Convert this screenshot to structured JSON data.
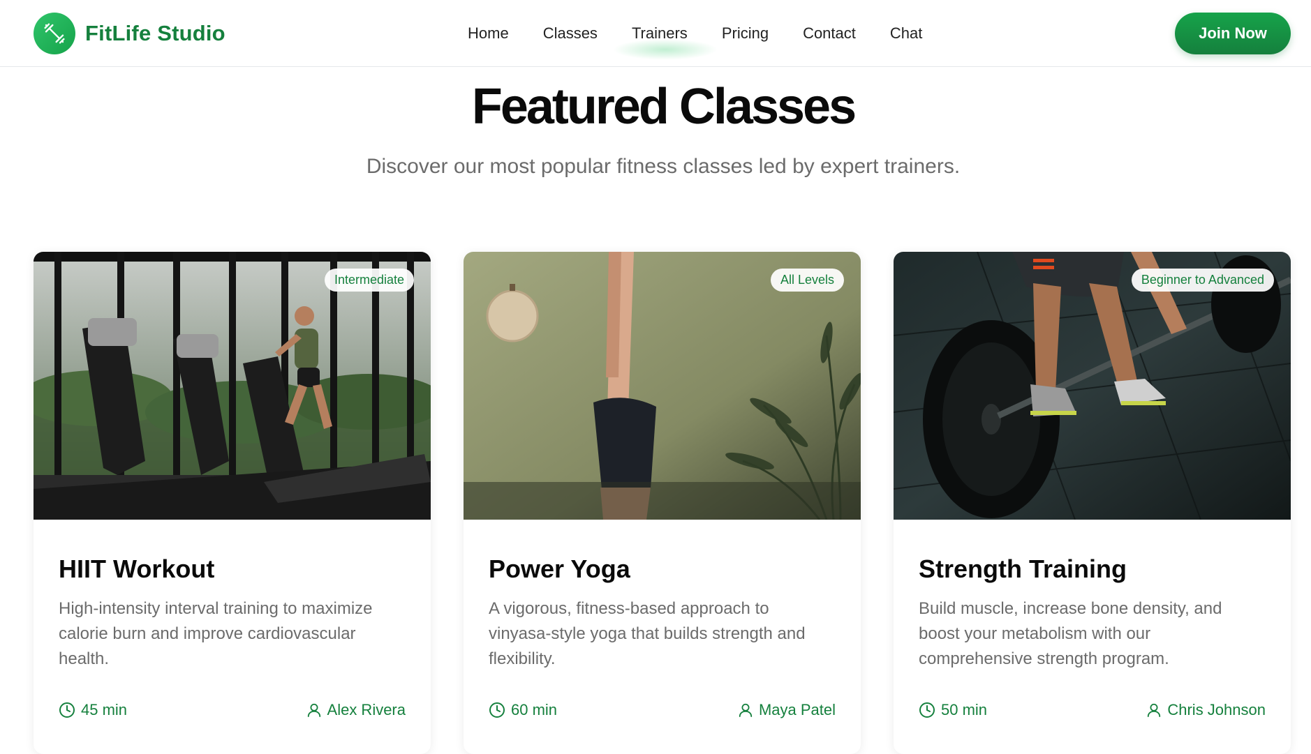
{
  "header": {
    "brand": "FitLife Studio",
    "logo_icon": "dumbbell-icon",
    "nav": [
      "Home",
      "Classes",
      "Trainers",
      "Pricing",
      "Contact",
      "Chat"
    ],
    "cta": "Join Now"
  },
  "section": {
    "title": "Featured Classes",
    "subtitle": "Discover our most popular fitness classes led by expert trainers."
  },
  "colors": {
    "accent": "#15803d",
    "accent_light": "#22c55e",
    "text_muted": "#6b6b6b"
  },
  "classes": [
    {
      "badge": "Intermediate",
      "title": "HIIT Workout",
      "description": "High-intensity interval training to maximize calorie burn and improve cardiovascular health.",
      "duration": "45 min",
      "trainer": "Alex Rivera",
      "image": "treadmill-gym-photo"
    },
    {
      "badge": "All Levels",
      "title": "Power Yoga",
      "description": "A vigorous, fitness-based approach to vinyasa-style yoga that builds strength and flexibility.",
      "duration": "60 min",
      "trainer": "Maya Patel",
      "image": "headstand-yoga-photo"
    },
    {
      "badge": "Beginner to Advanced",
      "title": "Strength Training",
      "description": "Build muscle, increase bone density, and boost your metabolism with our comprehensive strength program.",
      "duration": "50 min",
      "trainer": "Chris Johnson",
      "image": "barbell-deadlift-photo"
    }
  ]
}
